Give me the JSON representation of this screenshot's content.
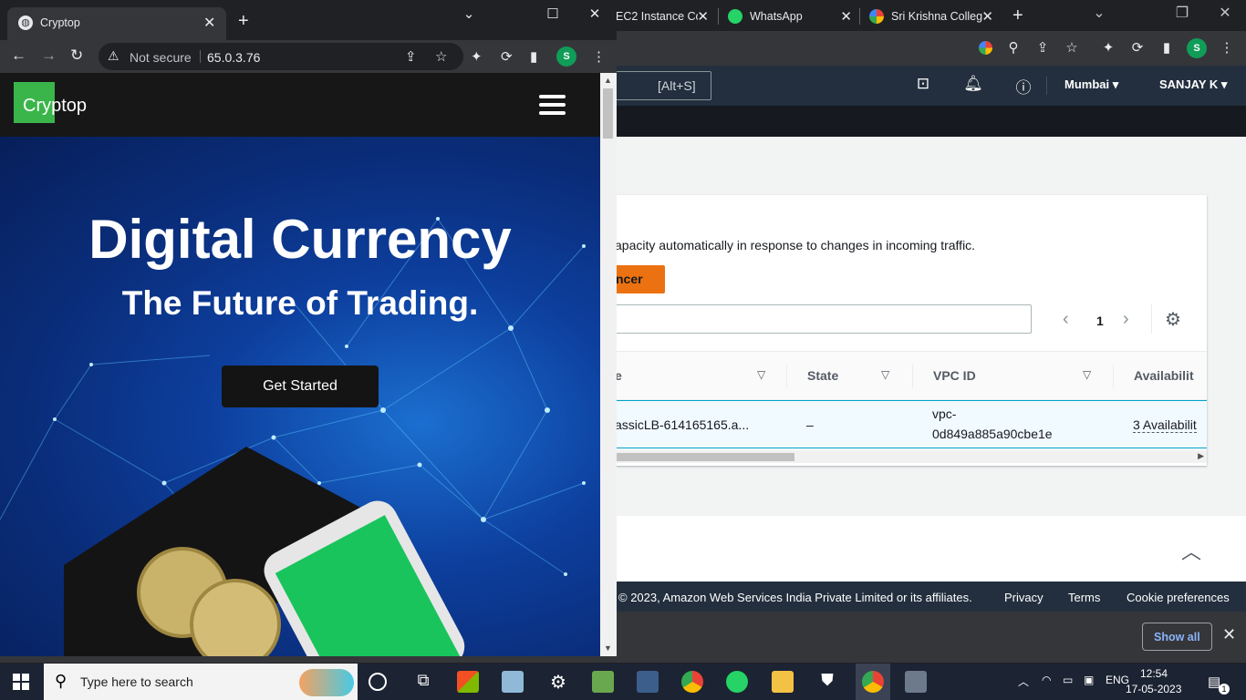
{
  "background_window": {
    "tabs": [
      {
        "title": "EC2 Instance Con"
      },
      {
        "title": "WhatsApp"
      },
      {
        "title": "Sri Krishna Colleg"
      }
    ],
    "aws": {
      "search_shortcut": "[Alt+S]",
      "region": "Mumbai",
      "user": "SANJAY K",
      "description": "apacity automatically in response to changes in incoming traffic.",
      "create_button": "ncer",
      "page_number": "1",
      "columns": [
        "e",
        "State",
        "VPC ID",
        "Availabilit"
      ],
      "row": {
        "name": "assicLB-614165165.a...",
        "state": "–",
        "vpc_line1": "vpc-",
        "vpc_line2": "0d849a885a90cbe1e",
        "availability": "3 Availabilit"
      },
      "footer": {
        "copyright": "2023, Amazon Web Services India Private Limited or its affiliates.",
        "privacy": "Privacy",
        "terms": "Terms",
        "cookies": "Cookie preferences"
      }
    },
    "downloads": {
      "show_all": "Show all"
    }
  },
  "front_window": {
    "tab_title": "Cryptop",
    "security": "Not secure",
    "url": "65.0.3.76",
    "profile_initial": "S",
    "site": {
      "logo": "Cryptop",
      "headline": "Digital Currency",
      "subheadline": "The Future of Trading.",
      "cta": "Get Started"
    }
  },
  "taskbar": {
    "search_placeholder": "Type here to search",
    "language": "ENG",
    "time": "12:54",
    "date": "17-05-2023",
    "notification_count": "1"
  },
  "colors": {
    "aws_nav": "#232f3e",
    "aws_orange": "#ec7211",
    "logo_green": "#3ab54a",
    "hero_blue": "#0d3f9e"
  }
}
